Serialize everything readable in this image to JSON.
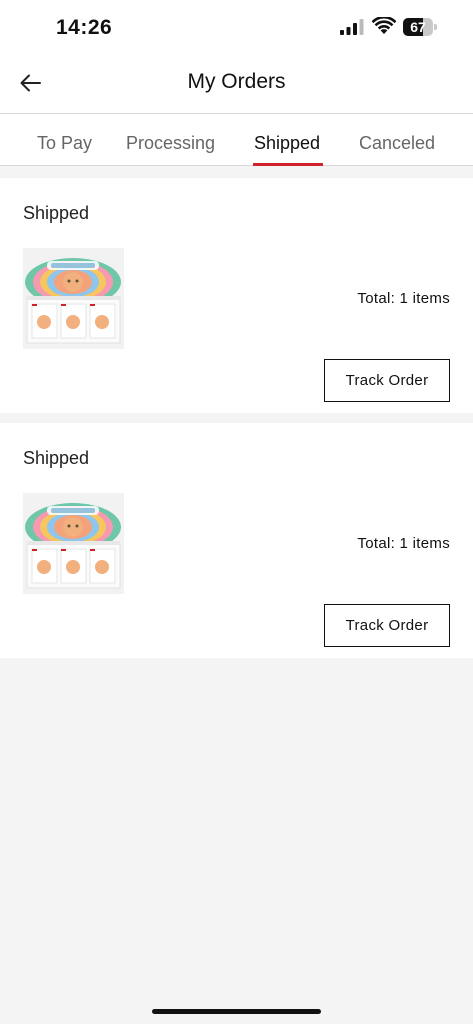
{
  "status_bar": {
    "time": "14:26",
    "battery_level": "67",
    "battery_fraction": 0.67,
    "icons": [
      "signal-icon",
      "wifi-icon",
      "battery-icon"
    ]
  },
  "header": {
    "back_icon": "arrow-left-icon",
    "title": "My Orders"
  },
  "tabs": [
    {
      "label": "To Pay",
      "active": false
    },
    {
      "label": "Processing",
      "active": false
    },
    {
      "label": "Shipped",
      "active": true
    },
    {
      "label": "Canceled",
      "active": false
    }
  ],
  "orders": [
    {
      "status": "Shipped",
      "total": "Total: 1 items",
      "button": "Track Order",
      "image": "blind-box-product-thumbnail"
    },
    {
      "status": "Shipped",
      "total": "Total: 1 items",
      "button": "Track Order",
      "image": "blind-box-product-thumbnail"
    }
  ],
  "colors": {
    "accent": "#d0222a",
    "background": "#f4f4f4",
    "card": "#ffffff"
  }
}
